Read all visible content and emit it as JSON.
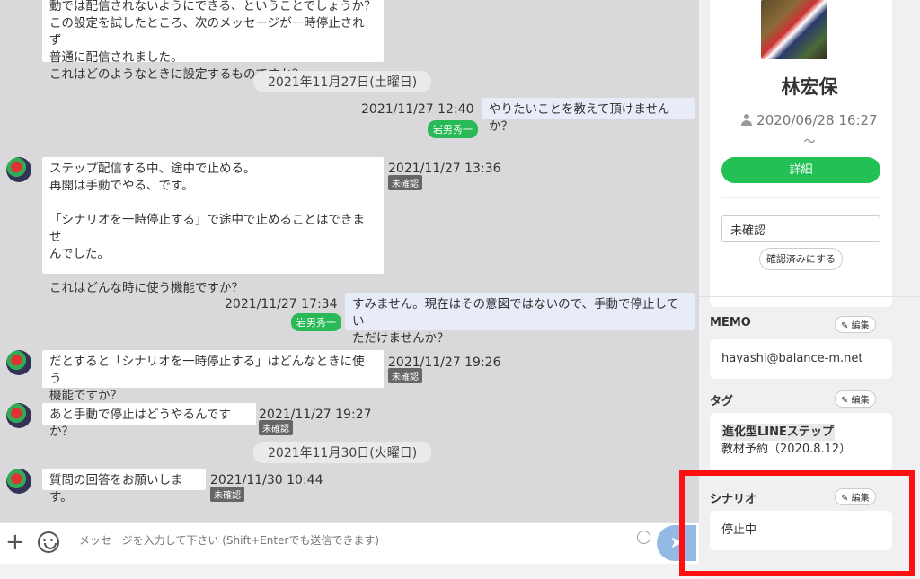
{
  "chat": {
    "messages": [
      {
        "text": "動では配信されないようにできる、ということでしょうか？\nこの設定を試したところ、次のメッセージが一時停止されず\n普通に配信されました。\nこれはどのようなときに設定するものですか？"
      },
      {
        "date": "2021年11月27日(土曜日)"
      },
      {
        "time": "2021/11/27 12:40",
        "text": "やりたいことを教えて頂けませんか？",
        "staff": "岩男秀一"
      },
      {
        "time": "2021/11/27 13:36",
        "status": "未確認",
        "text": "ステップ配信する中、途中で止める。\n再開は手動でやる、です。\n\n「シナリオを一時停止する」で途中で止めることはできませ\nんでした。\n\nこれはどんな時に使う機能ですか？"
      },
      {
        "time": "2021/11/27 17:34",
        "text": "すみません。現在はその意図ではないので、手動で停止してい\nただけませんか？",
        "staff": "岩男秀一"
      },
      {
        "time": "2021/11/27 19:26",
        "status": "未確認",
        "text": "だとすると「シナリオを一時停止する」はどんなときに使う\n機能ですか？"
      },
      {
        "time": "2021/11/27 19:27",
        "status": "未確認",
        "text": "あと手動で停止はどうやるんですか？"
      },
      {
        "date": "2021年11月30日(火曜日)"
      },
      {
        "time": "2021/11/30 10:44",
        "status": "未確認",
        "text": "質問の回答をお願いします。"
      }
    ]
  },
  "input": {
    "placeholder": "メッセージを入力して下さい (Shift+Enterでも送信できます)",
    "add_icon": "plus-icon",
    "emoji_icon": "smiley-icon",
    "send_icon": "send-icon"
  },
  "profile": {
    "name": "林宏保",
    "date": "2020/06/28 16:27",
    "tilde": "〜",
    "detail_button": "詳細",
    "status_value": "未確認",
    "confirm_button": "確認済みにする",
    "user_icon": "user-icon"
  },
  "memo": {
    "title": "MEMO",
    "edit": "編集",
    "text": "hayashi@balance-m.net"
  },
  "tags": {
    "title": "タグ",
    "edit": "編集",
    "items": [
      "進化型LINEステップ",
      "教材予約（2020.8.12）"
    ]
  },
  "scenario": {
    "title": "シナリオ",
    "edit": "編集",
    "text": "停止中"
  },
  "colors": {
    "green": "#22c055",
    "highlight": "#ff1010"
  }
}
